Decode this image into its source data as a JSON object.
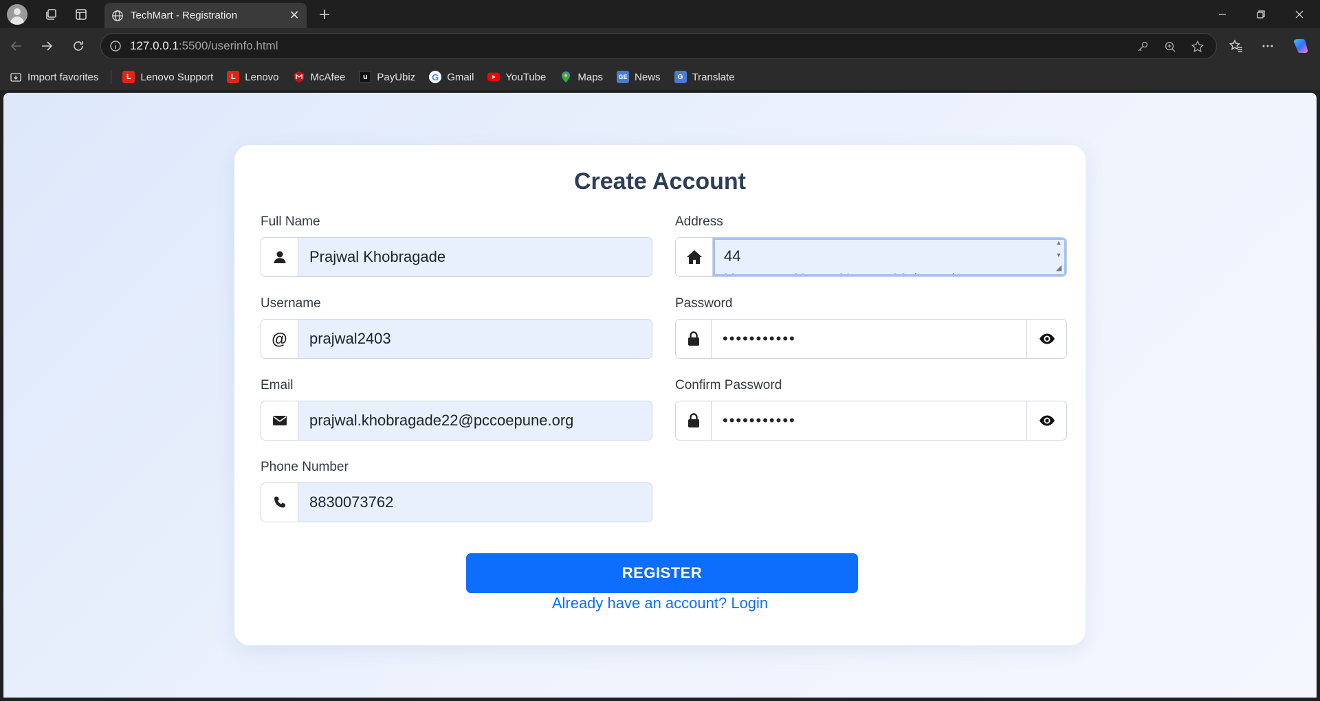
{
  "browser": {
    "tab_title": "TechMart - Registration",
    "url_host": "127.0.0.1",
    "url_path": ":5500/userinfo.html",
    "favorites": [
      {
        "label": "Import favorites",
        "icon": "import-icon",
        "color": "#2b2b2b"
      },
      {
        "label": "Lenovo Support",
        "icon": "lenovo-icon",
        "color": "#e2231a"
      },
      {
        "label": "Lenovo",
        "icon": "lenovo-icon",
        "color": "#e2231a"
      },
      {
        "label": "McAfee",
        "icon": "mcafee-icon",
        "color": "#c01818"
      },
      {
        "label": "PayUbiz",
        "icon": "payubiz-icon",
        "color": "#111111"
      },
      {
        "label": "Gmail",
        "icon": "google-icon",
        "color": "#ffffff"
      },
      {
        "label": "YouTube",
        "icon": "youtube-icon",
        "color": "#ff0000"
      },
      {
        "label": "Maps",
        "icon": "maps-icon",
        "color": "#34a853"
      },
      {
        "label": "News",
        "icon": "news-icon",
        "color": "#4a7bd0"
      },
      {
        "label": "Translate",
        "icon": "translate-icon",
        "color": "#4a7bd0"
      }
    ]
  },
  "form": {
    "title": "Create Account",
    "full_name": {
      "label": "Full Name",
      "value": "Prajwal Khobragade",
      "icon": "user-icon"
    },
    "username": {
      "label": "Username",
      "value": "prajwal2403",
      "icon": "at-icon"
    },
    "email": {
      "label": "Email",
      "value": "prajwal.khobragade22@pccoepune.org",
      "icon": "envelope-icon"
    },
    "phone": {
      "label": "Phone Number",
      "value": "8830073762",
      "icon": "phone-icon"
    },
    "address": {
      "label": "Address",
      "value_line1": "44",
      "value_line2": "Hanuman Nagar Nagpur Maharashtra",
      "icon": "home-icon"
    },
    "password": {
      "label": "Password",
      "value": "•••••••••••",
      "icon": "lock-icon"
    },
    "confirm_password": {
      "label": "Confirm Password",
      "value": "•••••••••••",
      "icon": "lock-icon"
    },
    "register_label": "REGISTER",
    "login_link": "Already have an account? Login"
  },
  "colors": {
    "primary": "#0d6efd",
    "autofill_bg": "#e8f0fe",
    "title": "#2c3e55"
  }
}
